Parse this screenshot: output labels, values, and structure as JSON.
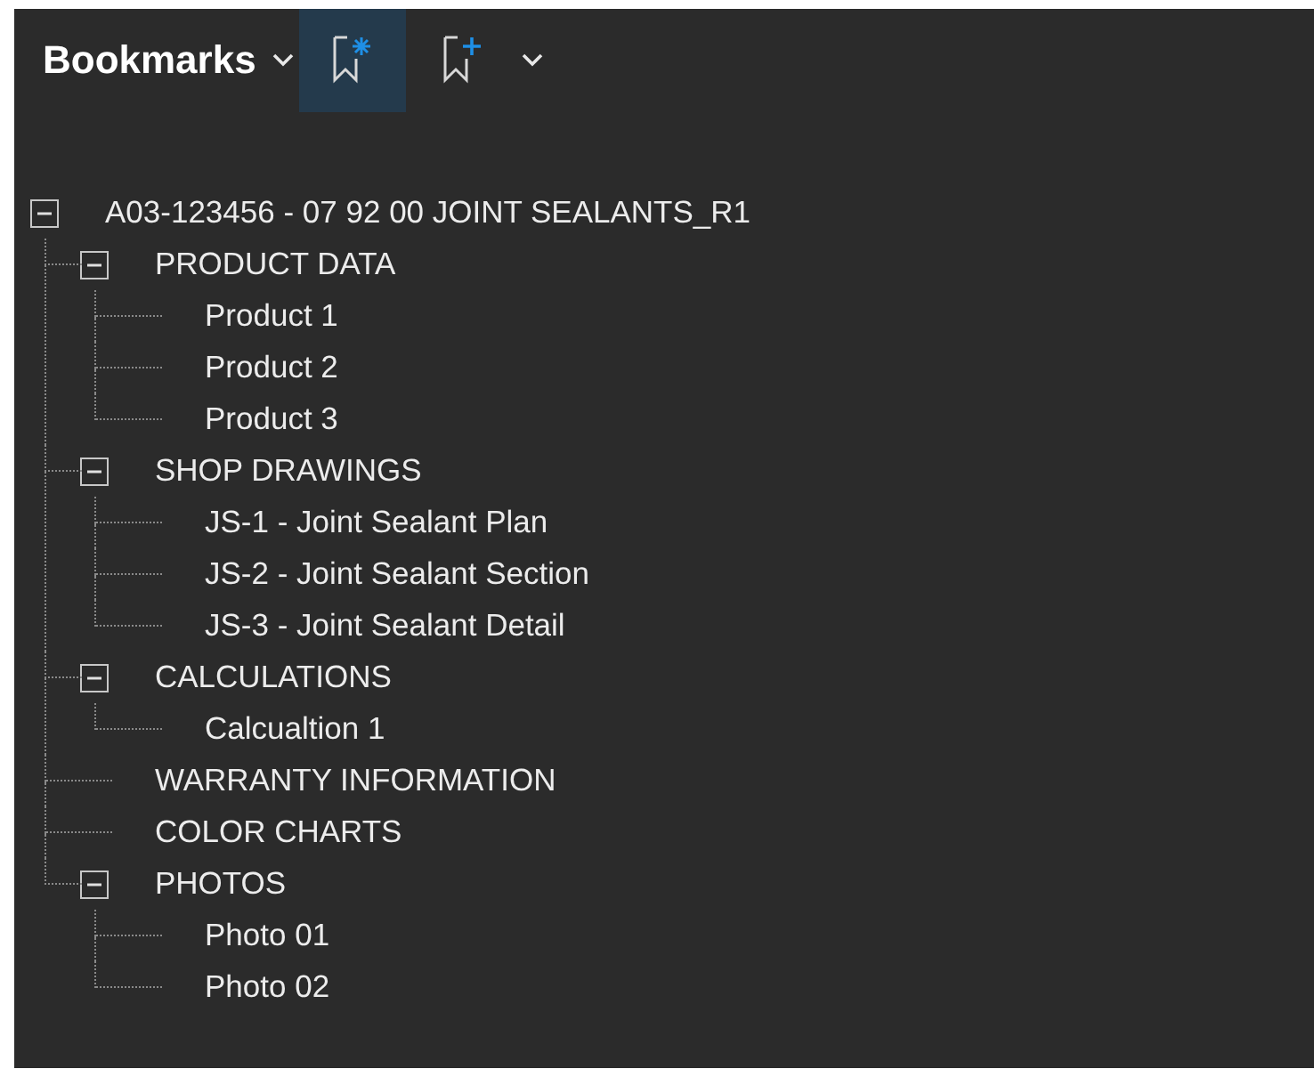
{
  "panel": {
    "title": "Bookmarks"
  },
  "toolbar": [
    {
      "kind": "new-bookmark",
      "selected": true
    },
    {
      "kind": "add-bookmark",
      "selected": false
    }
  ],
  "tree": [
    {
      "label": "A03-123456 - 07 92 00 JOINT SEALANTS_R1",
      "expanded": true,
      "children": [
        {
          "label": "PRODUCT DATA",
          "expanded": true,
          "children": [
            {
              "label": "Product 1"
            },
            {
              "label": "Product 2"
            },
            {
              "label": "Product 3"
            }
          ]
        },
        {
          "label": "SHOP DRAWINGS",
          "expanded": true,
          "children": [
            {
              "label": "JS-1 - Joint Sealant Plan"
            },
            {
              "label": "JS-2 - Joint Sealant Section"
            },
            {
              "label": "JS-3 - Joint Sealant Detail"
            }
          ]
        },
        {
          "label": "CALCULATIONS",
          "expanded": true,
          "children": [
            {
              "label": "Calcualtion 1"
            }
          ]
        },
        {
          "label": "WARRANTY INFORMATION"
        },
        {
          "label": "COLOR CHARTS"
        },
        {
          "label": "PHOTOS",
          "expanded": true,
          "children": [
            {
              "label": "Photo 01"
            },
            {
              "label": "Photo 02"
            }
          ]
        }
      ]
    }
  ]
}
